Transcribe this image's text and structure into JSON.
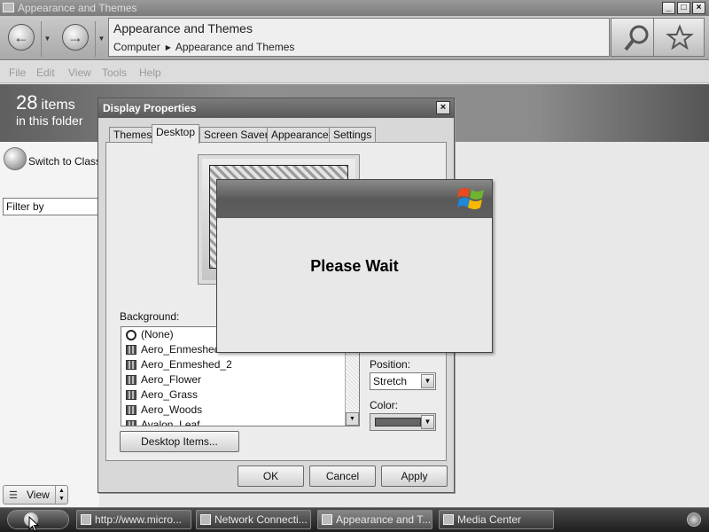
{
  "explorer": {
    "window_title": "Appearance and Themes",
    "address_title": "Appearance and Themes",
    "breadcrumb": [
      "Computer",
      "Appearance and Themes"
    ],
    "menu": [
      "File",
      "Edit",
      "View",
      "Tools",
      "Help"
    ],
    "item_count": "28",
    "item_count_unit": "items",
    "item_count_sub": "in this folder",
    "switch_classic": "Switch to Classic",
    "filter_value": "Filter by",
    "view_label": "View"
  },
  "display_properties": {
    "title": "Display Properties",
    "tabs": [
      "Themes",
      "Desktop",
      "Screen Saver",
      "Appearance",
      "Settings"
    ],
    "active_tab": "Desktop",
    "background_label": "Background:",
    "background_items": [
      "(None)",
      "Aero_Enmeshed",
      "Aero_Enmeshed_2",
      "Aero_Flower",
      "Aero_Grass",
      "Aero_Woods",
      "Avalon_Leaf"
    ],
    "position_label": "Position:",
    "position_value": "Stretch",
    "color_label": "Color:",
    "color_value": "#666666",
    "desktop_items_button": "Desktop Items...",
    "ok": "OK",
    "cancel": "Cancel",
    "apply": "Apply"
  },
  "wait_dialog": {
    "message": "Please Wait",
    "logo": "windows-flag-logo"
  },
  "taskbar": {
    "items": [
      "http://www.micro...",
      "Network Connecti...",
      "Appearance and T...",
      "Media Center"
    ],
    "active_index": 2
  }
}
